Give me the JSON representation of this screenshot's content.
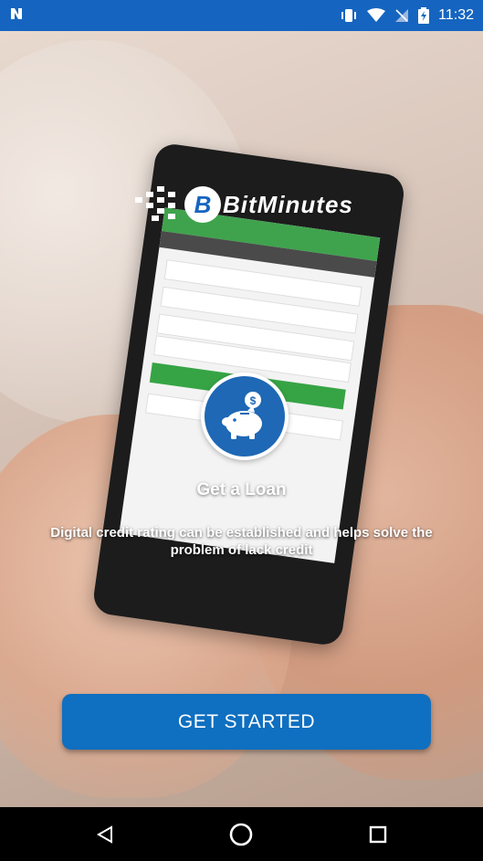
{
  "status_bar": {
    "left_icon": "n-icon",
    "icons": [
      "vibrate-icon",
      "wifi-icon",
      "no-signal-icon",
      "battery-charging-icon"
    ],
    "time": "11:32"
  },
  "brand": {
    "logo_icon": "bitminutes-logo-icon",
    "name": "BitMinutes"
  },
  "feature": {
    "icon": "piggy-bank-icon",
    "title": "Get a Loan",
    "description": "Digital credit rating can be established and helps solve the problem of lack credit"
  },
  "cta": {
    "label": "GET STARTED"
  },
  "nav_bar": {
    "buttons": [
      "back-icon",
      "home-icon",
      "recents-icon"
    ]
  },
  "colors": {
    "status_bar": "#1565c0",
    "accent": "#0f6fc0",
    "icon_circle": "#1e68b5"
  }
}
